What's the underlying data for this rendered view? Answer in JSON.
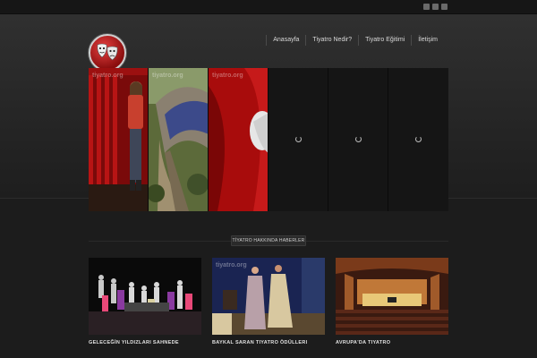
{
  "social": [
    "rss-icon",
    "facebook-icon",
    "twitter-icon"
  ],
  "brand": {
    "logo": "theatre-masks-icon"
  },
  "nav": {
    "items": [
      {
        "label": "Anasayfa"
      },
      {
        "label": "Tiyatro Nedir?"
      },
      {
        "label": "Tiyatro Eğitimi"
      },
      {
        "label": "İletişim"
      }
    ]
  },
  "slider": {
    "watermark": "tiyatro.org"
  },
  "section": {
    "title": "TİYATRO HAKKINDA HABERLER"
  },
  "news": [
    {
      "title": "GELECEĞİN YILDIZLARI SAHNEDE"
    },
    {
      "title": "BAYKAL SARAN TIYATRO ÖDÜLLERI"
    },
    {
      "title": "AVRUPA'DA TIYATRO"
    }
  ],
  "colors": {
    "accent": "#c01818",
    "background": "#1c1c1c"
  }
}
